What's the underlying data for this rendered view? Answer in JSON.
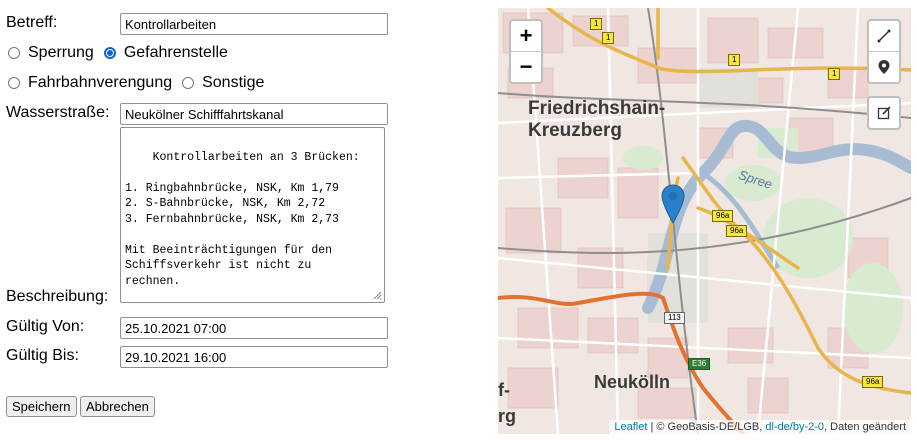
{
  "form": {
    "betreff_label": "Betreff:",
    "betreff_value": "Kontrollarbeiten",
    "type_options": [
      {
        "label": "Sperrung",
        "checked": false
      },
      {
        "label": "Gefahrenstelle",
        "checked": true
      },
      {
        "label": "Fahrbahnverengung",
        "checked": false
      },
      {
        "label": "Sonstige",
        "checked": false
      }
    ],
    "wasserstrasse_label": "Wasserstraße:",
    "wasserstrasse_value": "Neukölner Schifffahrtskanal",
    "beschreibung_label": "Beschreibung:",
    "beschreibung_value": "Kontrollarbeiten an 3 Brücken:\n\n1. Ringbahnbrücke, NSK, Km 1,79\n2. S-Bahnbrücke, NSK, Km 2,72\n3. Fernbahnbrücke, NSK, Km 2,73\n\nMit Beeinträchtigungen für den\nSchiffsverkehr ist nicht zu\nrechnen.",
    "gueltig_von_label": "Gültig Von:",
    "gueltig_von_value": "25.10.2021 07:00",
    "gueltig_bis_label": "Gültig Bis:",
    "gueltig_bis_value": "29.10.2021 16:00",
    "save_label": "Speichern",
    "cancel_label": "Abbrechen"
  },
  "map": {
    "zoom_in": "+",
    "zoom_out": "−",
    "place_friedrichshain_1": "Friedrichshain-",
    "place_friedrichshain_2": "Kreuzberg",
    "place_neukoelln": "Neukölln",
    "place_spree": "Spree",
    "edge_fragment_1": "f-",
    "edge_fragment_2": "rg",
    "road_labels": [
      "1",
      "1",
      "1",
      "1",
      "96a",
      "96a",
      "96a",
      "113",
      "E36"
    ],
    "marker_color": "#2a81cb",
    "tools": [
      "polyline-icon",
      "marker-icon",
      "edit-icon"
    ],
    "attribution": {
      "link": "Leaflet",
      "text1": " | © GeoBasis-DE/LGB, ",
      "license": "dl-de/by-2-0",
      "text2": ", Daten geändert"
    }
  }
}
